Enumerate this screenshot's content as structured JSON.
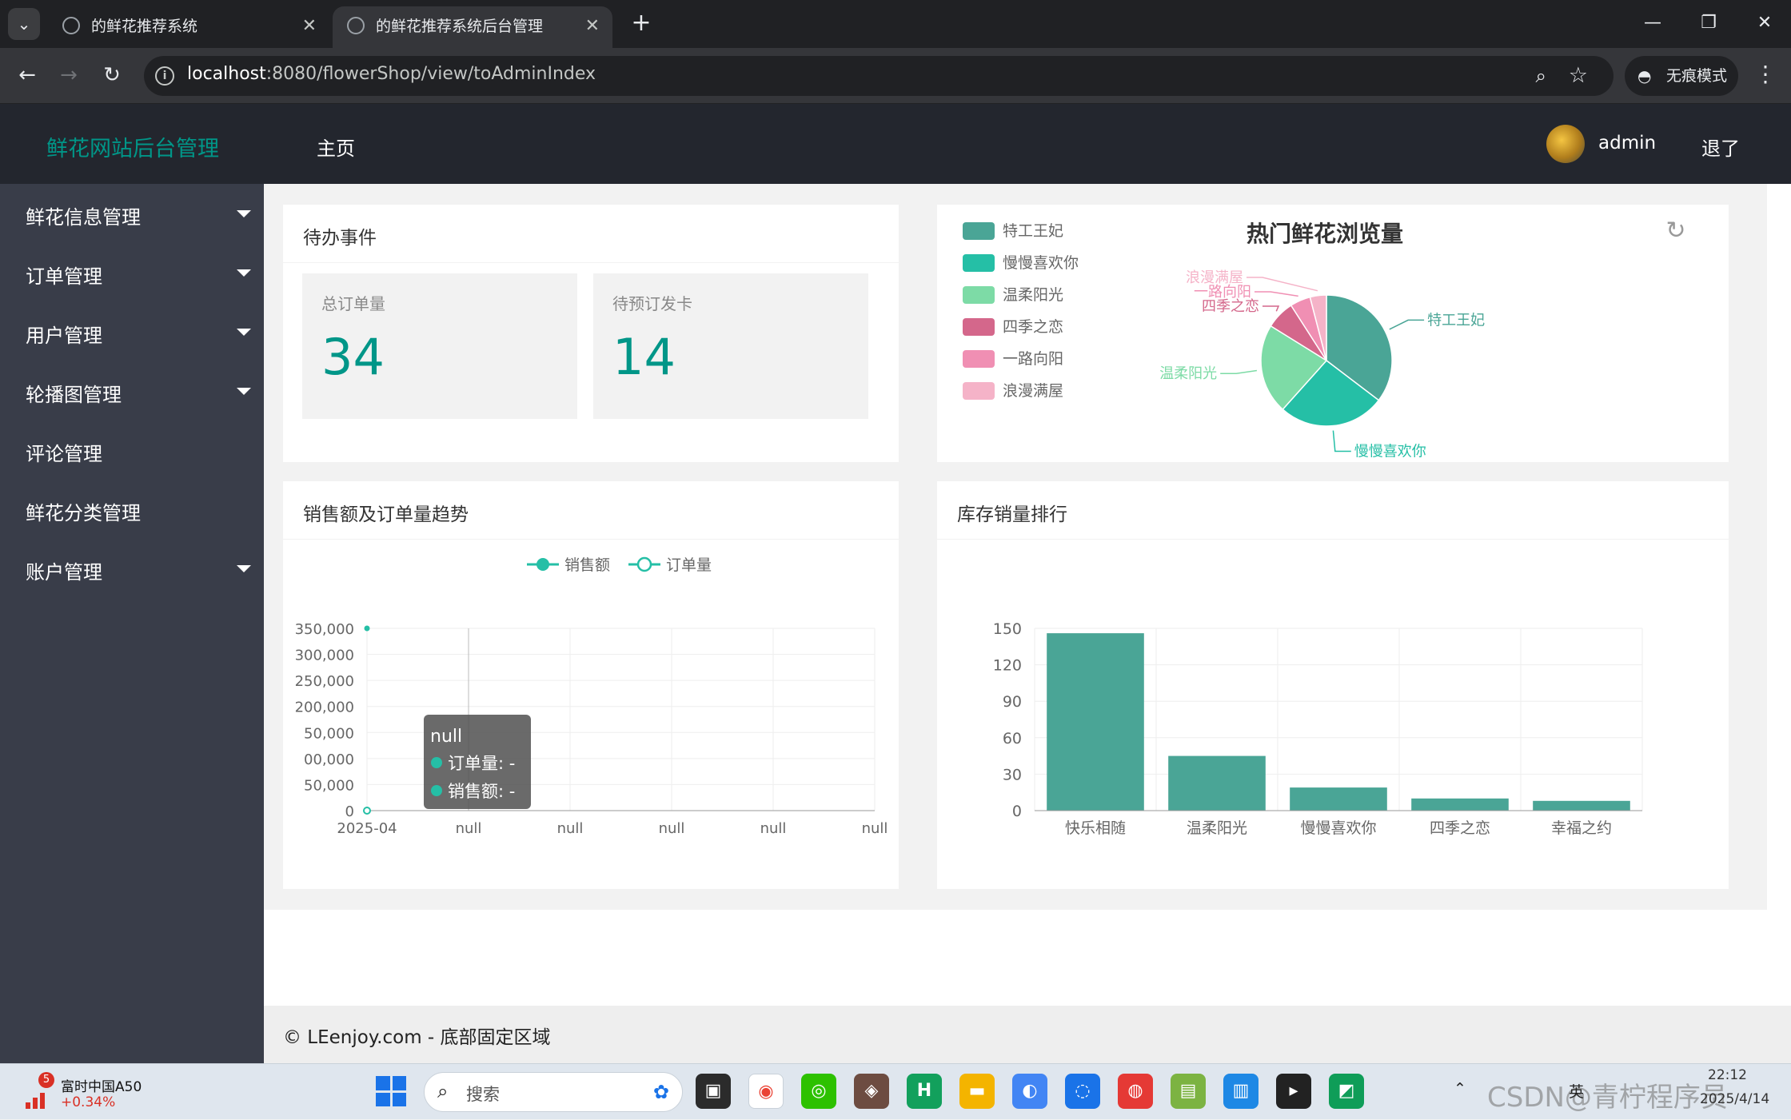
{
  "browser": {
    "tabs": [
      {
        "title": "的鲜花推荐系统",
        "active": false
      },
      {
        "title": "的鲜花推荐系统后台管理",
        "active": true
      }
    ],
    "url_host": "localhost",
    "url_path": ":8080/flowerShop/view/toAdminIndex",
    "incognito_label": "无痕模式"
  },
  "header": {
    "brand": "鲜花网站后台管理",
    "nav_home": "主页",
    "user_name": "admin",
    "logout": "退了"
  },
  "sidebar": {
    "items": [
      {
        "label": "鲜花信息管理",
        "has_caret": true
      },
      {
        "label": "订单管理",
        "has_caret": true
      },
      {
        "label": "用户管理",
        "has_caret": true
      },
      {
        "label": "轮播图管理",
        "has_caret": true
      },
      {
        "label": "评论管理",
        "has_caret": false
      },
      {
        "label": "鲜花分类管理",
        "has_caret": false
      },
      {
        "label": "账户管理",
        "has_caret": true
      }
    ]
  },
  "todo": {
    "title": "待办事件",
    "stats": [
      {
        "label": "总订单量",
        "value": "34"
      },
      {
        "label": "待预订发卡",
        "value": "14"
      }
    ]
  },
  "trend_card": {
    "title": "销售额及订单量趋势"
  },
  "stock_card": {
    "title": "库存销量排行"
  },
  "chart_data": [
    {
      "type": "pie",
      "title": "热门鲜花浏览量",
      "categories": [
        "特工王妃",
        "慢慢喜欢你",
        "温柔阳光",
        "四季之恋",
        "一路向阳",
        "浪漫满屋"
      ],
      "values": [
        35,
        26,
        22,
        7,
        5,
        4
      ],
      "colors": [
        "#4aa596",
        "#25bfa6",
        "#7ddba6",
        "#d4678b",
        "#f08fb3",
        "#f5b3c8"
      ],
      "legend": "left"
    },
    {
      "type": "line",
      "categories": [
        "2025-04",
        "null",
        "null",
        "null",
        "null",
        "null"
      ],
      "series": [
        {
          "name": "销售额",
          "values": [
            350000,
            null,
            null,
            null,
            null,
            null
          ]
        },
        {
          "name": "订单量",
          "values": [
            0,
            null,
            null,
            null,
            null,
            null
          ]
        }
      ],
      "yticks": [
        "0",
        "50,000",
        "00,000",
        "50,000",
        "200,000",
        "250,000",
        "300,000",
        "350,000"
      ],
      "ylim": [
        0,
        350000
      ],
      "grid": true,
      "legend": "top-center",
      "tooltip": {
        "title": "null",
        "rows": [
          "订单量: -",
          "销售额: -"
        ]
      }
    },
    {
      "type": "bar",
      "categories": [
        "快乐相随",
        "温柔阳光",
        "慢慢喜欢你",
        "四季之恋",
        "幸福之约"
      ],
      "values": [
        146,
        45,
        19,
        10,
        8
      ],
      "ylim": [
        0,
        150
      ],
      "yticks": [
        0,
        30,
        60,
        90,
        120,
        150
      ],
      "color": "#4aa596",
      "grid": true
    }
  ],
  "footer": {
    "text": "© LEenjoy.com - 底部固定区域"
  },
  "taskbar": {
    "stock_badge": "5",
    "stock_name": "富时中国A50",
    "stock_change": "+0.34%",
    "search_label": "搜索",
    "lang": "英",
    "time": "22:12",
    "date": "2025/4/14"
  }
}
